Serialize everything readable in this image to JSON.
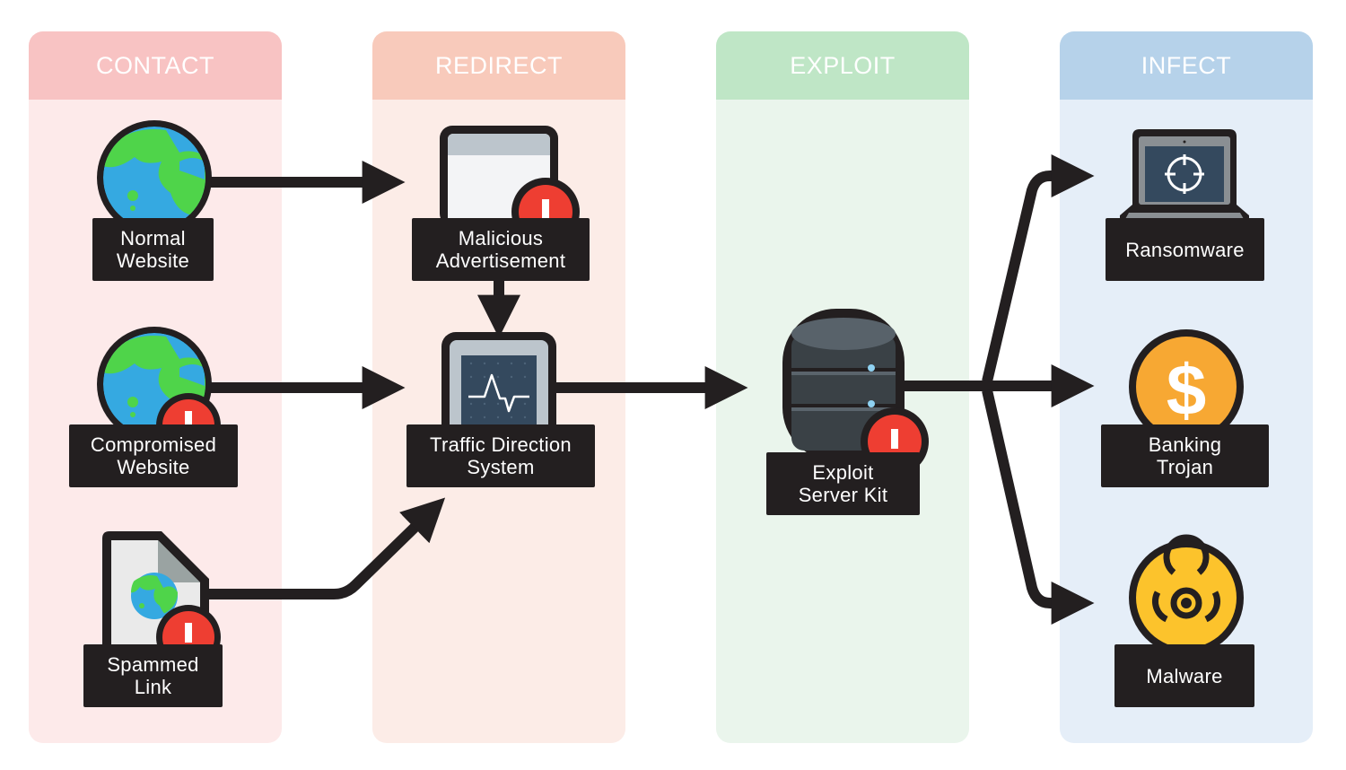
{
  "columns": [
    {
      "id": "contact",
      "title": "CONTACT",
      "header_color": "#f8c3c3",
      "body_color": "#fdeaea"
    },
    {
      "id": "redirect",
      "title": "REDIRECT",
      "header_color": "#f8cabb",
      "body_color": "#fcece7"
    },
    {
      "id": "exploit",
      "title": "EXPLOIT",
      "header_color": "#bfe6c6",
      "body_color": "#eaf5ec"
    },
    {
      "id": "infect",
      "title": "INFECT",
      "header_color": "#b6d2ea",
      "body_color": "#e5eef8"
    }
  ],
  "nodes": {
    "normal_website": {
      "line1": "Normal",
      "line2": "Website",
      "icon": "globe-icon"
    },
    "compromised_website": {
      "line1": "Compromised",
      "line2": "Website",
      "icon": "globe-icon",
      "alert": true
    },
    "spammed_link": {
      "line1": "Spammed",
      "line2": "Link",
      "icon": "document-globe-icon",
      "alert": true
    },
    "malicious_ad": {
      "line1": "Malicious",
      "line2": "Advertisement",
      "icon": "browser-window-icon",
      "alert": true
    },
    "tds": {
      "line1": "Traffic Direction",
      "line2": "System",
      "icon": "monitor-pulse-icon"
    },
    "exploit_kit": {
      "line1": "Exploit",
      "line2": "Server Kit",
      "icon": "database-server-icon",
      "alert": true
    },
    "ransomware": {
      "line1": "Ransomware",
      "icon": "laptop-crosshair-icon"
    },
    "banking_trojan": {
      "line1": "Banking",
      "line2": "Trojan",
      "icon": "dollar-coin-icon"
    },
    "malware": {
      "line1": "Malware",
      "icon": "biohazard-icon"
    }
  },
  "edges": [
    {
      "from": "normal_website",
      "to": "malicious_ad"
    },
    {
      "from": "malicious_ad",
      "to": "tds"
    },
    {
      "from": "compromised_website",
      "to": "tds"
    },
    {
      "from": "spammed_link",
      "to": "tds"
    },
    {
      "from": "tds",
      "to": "exploit_kit"
    },
    {
      "from": "exploit_kit",
      "to": "ransomware"
    },
    {
      "from": "exploit_kit",
      "to": "banking_trojan"
    },
    {
      "from": "exploit_kit",
      "to": "malware"
    }
  ],
  "colors": {
    "arrow": "#231f20",
    "alert": "#ee3e32",
    "globe_water": "#35a9e1",
    "globe_land": "#4fd44a",
    "coin": "#f7a833",
    "biohazard": "#fcc32c",
    "screen": "#34495e"
  }
}
